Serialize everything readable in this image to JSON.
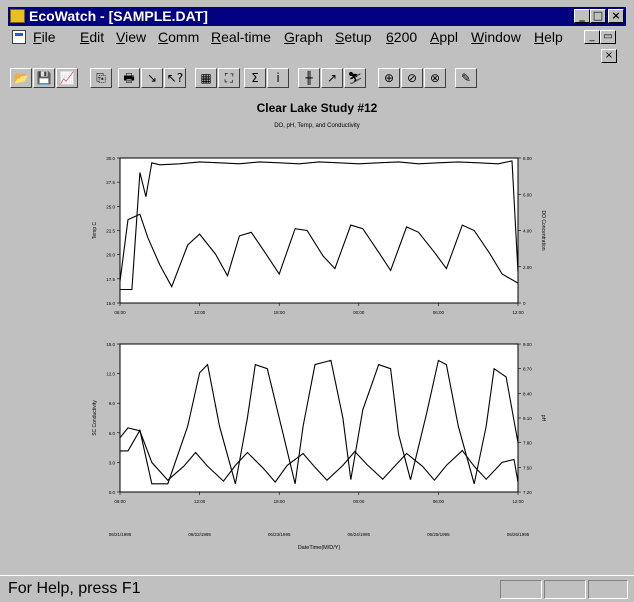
{
  "window": {
    "title": "EcoWatch - [SAMPLE.DAT]"
  },
  "titlebar_buttons": [
    "_",
    "□",
    "×"
  ],
  "mdi_buttons": [
    "_",
    "▭"
  ],
  "mdi_close": "×",
  "menu": [
    {
      "label": "File",
      "ul": "F",
      "rest": "ile"
    },
    {
      "label": "Edit",
      "ul": "E",
      "rest": "dit"
    },
    {
      "label": "View",
      "ul": "V",
      "rest": "iew"
    },
    {
      "label": "Comm",
      "ul": "C",
      "rest": "omm"
    },
    {
      "label": "Real-time",
      "ul": "R",
      "rest": "eal-time"
    },
    {
      "label": "Graph",
      "ul": "G",
      "rest": "raph"
    },
    {
      "label": "Setup",
      "ul": "S",
      "rest": "etup"
    },
    {
      "label": "6200",
      "ul": "6",
      "rest": "200"
    },
    {
      "label": "Appl",
      "ul": "A",
      "rest": "ppl"
    },
    {
      "label": "Window",
      "ul": "W",
      "rest": "indow"
    },
    {
      "label": "Help",
      "ul": "H",
      "rest": "elp"
    }
  ],
  "toolbar": [
    {
      "name": "open-icon",
      "glyph": "📂"
    },
    {
      "name": "save-icon",
      "glyph": "💾"
    },
    {
      "name": "graph-wizard-icon",
      "glyph": "📈"
    },
    {
      "name": "copy-icon",
      "glyph": "⎘"
    },
    {
      "name": "print-icon",
      "glyph": "🖶"
    },
    {
      "name": "tools-icon",
      "glyph": "↘"
    },
    {
      "name": "context-help-icon",
      "glyph": "↖?"
    },
    {
      "name": "table-icon",
      "glyph": "▦"
    },
    {
      "name": "graph-icon",
      "glyph": "⛶"
    },
    {
      "name": "statistics-icon",
      "glyph": "Σ"
    },
    {
      "name": "info-icon",
      "glyph": "i"
    },
    {
      "name": "cursor-icon",
      "glyph": "╫"
    },
    {
      "name": "zoom-pen-icon",
      "glyph": "↗"
    },
    {
      "name": "plot-icon",
      "glyph": "⛷"
    },
    {
      "name": "zoom-in-icon",
      "glyph": "⊕"
    },
    {
      "name": "zoom-pan-icon",
      "glyph": "⊘"
    },
    {
      "name": "zoom-out-icon",
      "glyph": "⊗"
    },
    {
      "name": "edit-plot-icon",
      "glyph": "✎"
    }
  ],
  "report": {
    "title": "Clear Lake Study #12",
    "subtitle": "DO, pH, Temp, and Conductivity"
  },
  "status": {
    "text": "For Help, press F1"
  },
  "chart_data": [
    {
      "type": "line",
      "ylabel": "Temp C",
      "y2label": "DO Concentration",
      "ylim": [
        15.0,
        30.0
      ],
      "y2lim": [
        0.0,
        8.0
      ],
      "yticks": [
        "30.0",
        "27.5",
        "25.0",
        "22.5",
        "20.0",
        "17.5",
        "15.0"
      ],
      "y2ticks": [
        "8.00",
        "6.00",
        "4.00",
        "2.00",
        "0"
      ],
      "xticks": [
        "06:00",
        "12:00",
        "18:00",
        "00:00",
        "06:00",
        "12:00"
      ],
      "series": [
        {
          "x": [
            0,
            0.03,
            0.05,
            0.065,
            0.08,
            0.1,
            0.15,
            0.2,
            0.25,
            0.3,
            0.35,
            0.4,
            0.45,
            0.5,
            0.55,
            0.6,
            0.65,
            0.7,
            0.75,
            0.8,
            0.85,
            0.9,
            0.95,
            0.985,
            1.0
          ],
          "y": [
            16.4,
            16.4,
            28.5,
            26.0,
            29.5,
            29.3,
            29.4,
            29.6,
            29.5,
            29.4,
            29.6,
            29.5,
            29.4,
            29.6,
            29.5,
            29.4,
            29.5,
            29.6,
            29.4,
            29.5,
            29.6,
            29.5,
            29.4,
            29.7,
            18.2
          ]
        },
        {
          "x": [
            0,
            0.02,
            0.05,
            0.07,
            0.1,
            0.13,
            0.17,
            0.2,
            0.24,
            0.27,
            0.3,
            0.33,
            0.37,
            0.4,
            0.44,
            0.47,
            0.51,
            0.54,
            0.58,
            0.61,
            0.65,
            0.68,
            0.72,
            0.75,
            0.79,
            0.82,
            0.86,
            0.89,
            0.93,
            0.96,
            1.0
          ],
          "y": [
            1.2,
            4.6,
            4.9,
            3.6,
            2.1,
            0.9,
            3.2,
            3.8,
            2.7,
            1.5,
            3.7,
            3.9,
            2.6,
            1.6,
            4.1,
            4.0,
            2.6,
            1.9,
            4.3,
            4.1,
            2.8,
            1.8,
            4.2,
            3.9,
            2.8,
            1.9,
            4.3,
            4.0,
            2.7,
            1.6,
            1.1
          ]
        }
      ]
    },
    {
      "type": "line",
      "ylabel": "SC Conductivity",
      "y2label": "pH",
      "ylim": [
        0.0,
        15.0
      ],
      "y2lim": [
        7.2,
        9.0
      ],
      "yticks": [
        "15.0",
        "12.0",
        "9.0",
        "6.0",
        "3.0",
        "0.0"
      ],
      "y2ticks": [
        "9.00",
        "8.70",
        "8.40",
        "8.10",
        "7.80",
        "7.50",
        "7.20"
      ],
      "xticks": [
        "06:00",
        "12:00",
        "18:00",
        "00:00",
        "06:00",
        "12:00"
      ],
      "xdates": [
        "06/21/1995",
        "06/22/1995",
        "06/23/1995",
        "06/24/1995",
        "06/25/1995",
        "06/26/1995"
      ],
      "xlabel": "DateTime(M/D/Y)",
      "series": [
        {
          "x": [
            0,
            0.02,
            0.05,
            0.08,
            0.12,
            0.16,
            0.19,
            0.22,
            0.26,
            0.29,
            0.32,
            0.36,
            0.39,
            0.42,
            0.46,
            0.49,
            0.52,
            0.56,
            0.59,
            0.62,
            0.66,
            0.69,
            0.72,
            0.76,
            0.79,
            0.82,
            0.86,
            0.89,
            0.92,
            0.96,
            0.99,
            1.0
          ],
          "y": [
            5.5,
            6.5,
            6.2,
            3.0,
            1.2,
            2.6,
            4.0,
            2.6,
            1.1,
            2.7,
            4.0,
            2.4,
            1.0,
            2.7,
            3.9,
            2.5,
            1.2,
            2.7,
            4.1,
            2.8,
            1.3,
            2.6,
            3.9,
            2.6,
            1.2,
            2.7,
            4.2,
            2.6,
            1.3,
            3.0,
            3.3,
            1.0
          ]
        },
        {
          "x": [
            0,
            0.02,
            0.05,
            0.08,
            0.12,
            0.17,
            0.2,
            0.22,
            0.25,
            0.29,
            0.32,
            0.34,
            0.37,
            0.41,
            0.44,
            0.46,
            0.49,
            0.53,
            0.56,
            0.58,
            0.61,
            0.65,
            0.68,
            0.7,
            0.73,
            0.77,
            0.8,
            0.82,
            0.85,
            0.89,
            0.92,
            0.94,
            0.97,
            1.0
          ],
          "y": [
            7.7,
            7.7,
            7.95,
            7.3,
            7.3,
            8.0,
            8.65,
            8.75,
            8.0,
            7.3,
            8.1,
            8.75,
            8.7,
            7.9,
            7.3,
            8.0,
            8.75,
            8.8,
            8.1,
            7.35,
            8.2,
            8.75,
            8.7,
            7.9,
            7.35,
            8.15,
            8.8,
            8.75,
            8.0,
            7.3,
            8.0,
            8.7,
            8.6,
            7.8
          ]
        }
      ]
    }
  ]
}
